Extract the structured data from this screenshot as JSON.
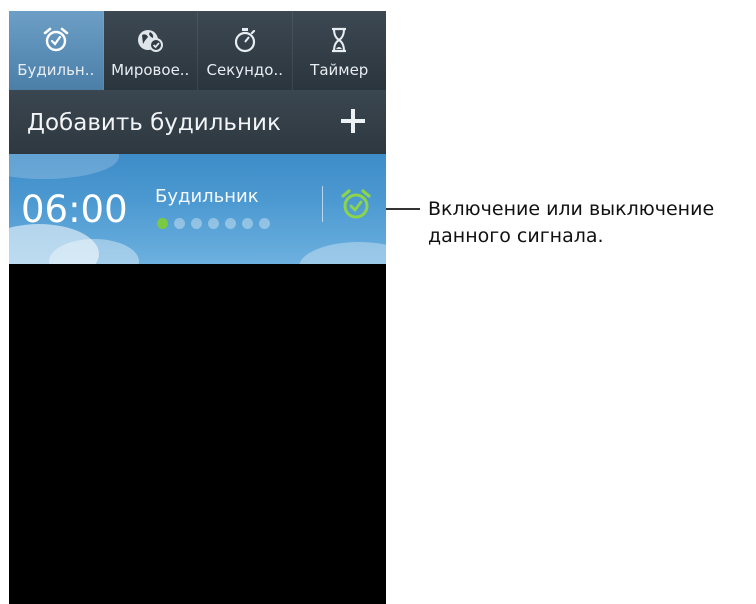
{
  "tabs": [
    {
      "label": "Будильн..",
      "icon": "alarm-clock-icon",
      "active": true
    },
    {
      "label": "Мировое..",
      "icon": "world-clock-icon",
      "active": false
    },
    {
      "label": "Секундо..",
      "icon": "stopwatch-icon",
      "active": false
    },
    {
      "label": "Таймер",
      "icon": "hourglass-icon",
      "active": false
    }
  ],
  "add_alarm": {
    "label": "Добавить будильник",
    "icon": "plus-icon"
  },
  "alarm": {
    "time": "06:00",
    "name": "Будильник",
    "toggle_icon": "alarm-on-icon",
    "toggle_color": "#8cd44a"
  },
  "callout": {
    "line1": "Включение или выключение",
    "line2": "данного сигнала."
  },
  "colors": {
    "active_tab": "#5b8fba",
    "alarm_bg": "#4d9ad2",
    "toggle_green": "#8cd44a"
  }
}
